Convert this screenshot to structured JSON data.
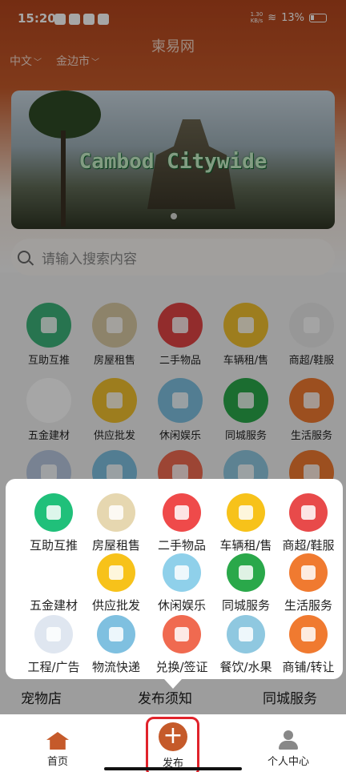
{
  "status_bar": {
    "time": "15:20",
    "net_speed_top": "1.30",
    "net_speed_bottom": "KB/s",
    "battery": "13%"
  },
  "header": {
    "title": "柬易网",
    "language": "中文",
    "city": "金边市"
  },
  "banner": {
    "caption": "Cambod Citywide"
  },
  "search": {
    "placeholder": "请输入搜索内容"
  },
  "background_grid": [
    {
      "label": "互助互推",
      "color": "#3db37a"
    },
    {
      "label": "房屋租售",
      "color": "#d9c9a3"
    },
    {
      "label": "二手物品",
      "color": "#e04444"
    },
    {
      "label": "车辆租/售",
      "color": "#f2c12e"
    },
    {
      "label": "商超/鞋服",
      "color": "#e8e8e8"
    },
    {
      "label": "五金建材",
      "color": "#ffffff"
    },
    {
      "label": "供应批发",
      "color": "#f2c12e"
    },
    {
      "label": "休闲娱乐",
      "color": "#7fc0e0"
    },
    {
      "label": "同城服务",
      "color": "#2aa84a"
    },
    {
      "label": "生活服务",
      "color": "#f07a30"
    }
  ],
  "popup": {
    "items": [
      {
        "label": "互助互推",
        "color": "#20c07a",
        "icon": "person-icon"
      },
      {
        "label": "房屋租售",
        "color": "#e6d7b0",
        "icon": "building-icon"
      },
      {
        "label": "二手物品",
        "color": "#ef4a4a",
        "icon": "recycle-icon"
      },
      {
        "label": "车辆租/售",
        "color": "#f7c21a",
        "icon": "car-icon"
      },
      {
        "label": "商超/鞋服",
        "color": "#e84a4a",
        "icon": "cart-icon"
      },
      {
        "label": "五金建材",
        "color": "#ffffff",
        "icon": "pipes-icon"
      },
      {
        "label": "供应批发",
        "color": "#f7c21a",
        "icon": "laptop-icon"
      },
      {
        "label": "休闲娱乐",
        "color": "#8fd0ea",
        "icon": "beach-icon"
      },
      {
        "label": "同城服务",
        "color": "#2aa84a",
        "icon": "city-service-icon"
      },
      {
        "label": "生活服务",
        "color": "#f07a30",
        "icon": "heart-hand-icon"
      },
      {
        "label": "工程/广告",
        "color": "#dfe6f0",
        "icon": "map-icon"
      },
      {
        "label": "物流快递",
        "color": "#7fc0e0",
        "icon": "truck-icon"
      },
      {
        "label": "兑换/签证",
        "color": "#f06a50",
        "icon": "id-card-icon"
      },
      {
        "label": "餐饮/水果",
        "color": "#8fc8e0",
        "icon": "cutlery-icon"
      },
      {
        "label": "商铺/转让",
        "color": "#f07a30",
        "icon": "r-logo-icon"
      }
    ]
  },
  "strip": {
    "left": "宠物店",
    "center": "发布须知",
    "right": "同城服务"
  },
  "tabbar": {
    "home": "首页",
    "publish": "发布",
    "profile": "个人中心",
    "accent": "#c55a2a",
    "highlight": "#e0232b"
  }
}
